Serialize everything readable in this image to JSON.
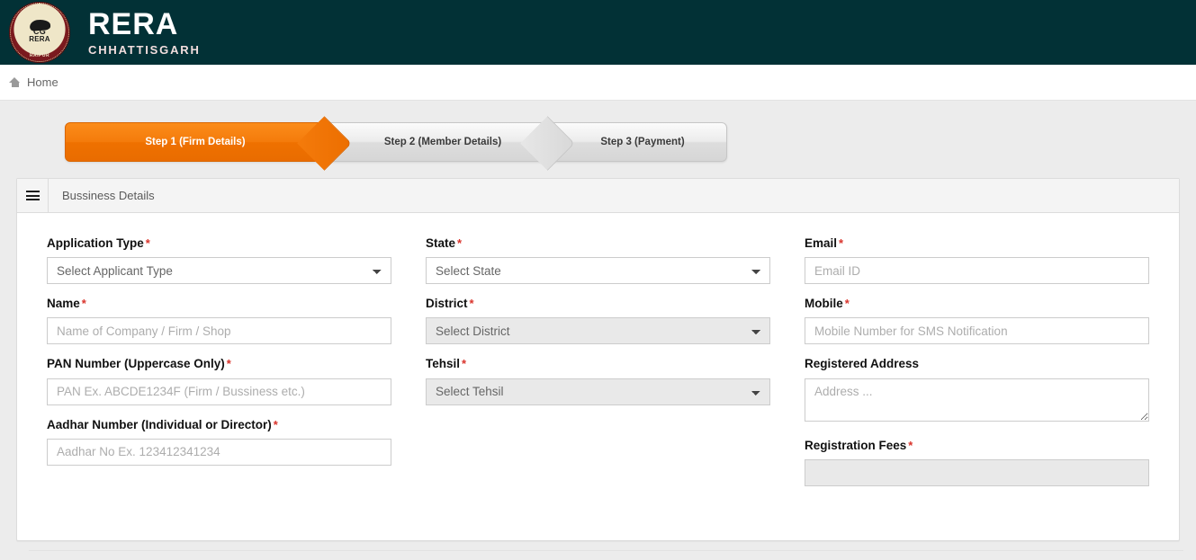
{
  "header": {
    "logo_icon": "cg-rera-seal-icon",
    "logo_alt": "CG RERA RAIPUR",
    "brand_main": "RERA",
    "brand_sub": "CHHATTISGARH"
  },
  "breadcrumb": {
    "home_icon": "home-icon",
    "home_label": "Home"
  },
  "wizard": {
    "steps": [
      {
        "label": "Step 1 (Firm Details)",
        "state": "active"
      },
      {
        "label": "Step 2 (Member Details)",
        "state": "inactive"
      },
      {
        "label": "Step 3 (Payment)",
        "state": "inactive"
      }
    ]
  },
  "panel": {
    "menu_icon": "hamburger-menu-icon",
    "title": "Bussiness Details"
  },
  "form": {
    "columns": [
      {
        "fields": [
          {
            "label": "Application Type",
            "required": true,
            "type": "select",
            "value": "Select Applicant Type",
            "disabled": false
          },
          {
            "label": "Name",
            "required": true,
            "type": "text",
            "value": "",
            "placeholder": "Name of Company / Firm / Shop",
            "disabled": false
          },
          {
            "label": "PAN Number (Uppercase Only)",
            "required": true,
            "type": "text",
            "value": "",
            "placeholder": "PAN Ex. ABCDE1234F (Firm / Bussiness etc.)",
            "disabled": false
          },
          {
            "label": "Aadhar Number (Individual or Director)",
            "required": true,
            "type": "text",
            "value": "",
            "placeholder": "Aadhar No Ex. 123412341234",
            "disabled": false
          }
        ]
      },
      {
        "fields": [
          {
            "label": "State",
            "required": true,
            "type": "select",
            "value": "Select State",
            "disabled": false
          },
          {
            "label": "District",
            "required": true,
            "type": "select",
            "value": "Select District",
            "disabled": true
          },
          {
            "label": "Tehsil",
            "required": true,
            "type": "select",
            "value": "Select Tehsil",
            "disabled": true
          }
        ]
      },
      {
        "fields": [
          {
            "label": "Email",
            "required": true,
            "type": "text",
            "value": "",
            "placeholder": "Email ID",
            "disabled": false
          },
          {
            "label": "Mobile",
            "required": true,
            "type": "text",
            "value": "",
            "placeholder": "Mobile Number for SMS Notification",
            "disabled": false
          },
          {
            "label": "Registered Address",
            "required": false,
            "type": "textarea",
            "value": "",
            "placeholder": "Address ...",
            "disabled": false
          },
          {
            "label": "Registration Fees",
            "required": true,
            "type": "text",
            "value": "",
            "placeholder": "",
            "disabled": true
          }
        ]
      }
    ]
  },
  "colors": {
    "header_bg": "#023136",
    "accent_orange": "#f47b0b",
    "required_red": "#d9332b",
    "page_bg": "#ececec"
  }
}
